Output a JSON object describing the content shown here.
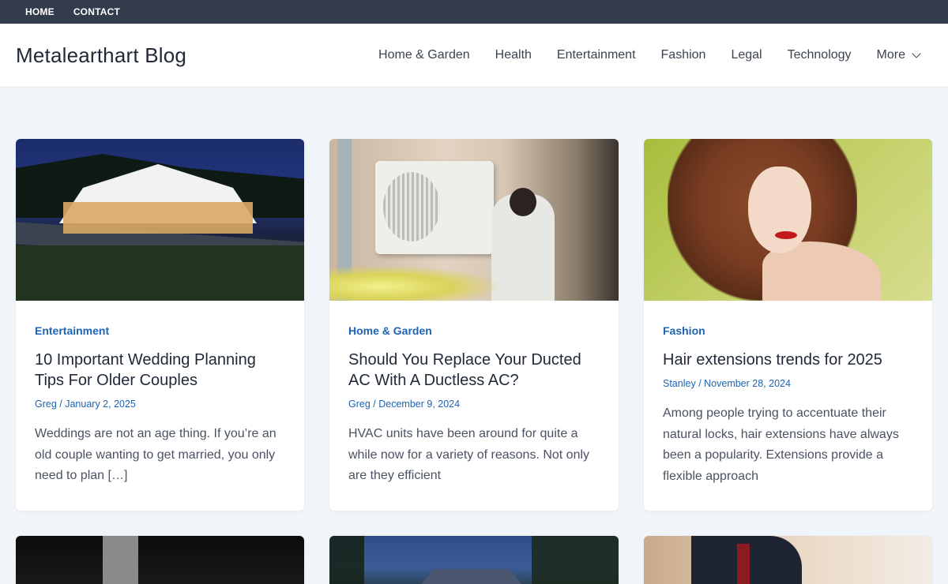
{
  "topbar": {
    "links": [
      "HOME",
      "CONTACT"
    ]
  },
  "header": {
    "logo": "Metalearthart Blog",
    "nav": [
      "Home & Garden",
      "Health",
      "Entertainment",
      "Fashion",
      "Legal",
      "Technology",
      "More"
    ]
  },
  "posts": [
    {
      "category": "Entertainment",
      "title": "10 Important Wedding Planning Tips For Older Couples",
      "author": "Greg",
      "date": "January 2, 2025",
      "excerpt": "Weddings are not an age thing. If you’re an old couple wanting to get married, you only need to plan […]"
    },
    {
      "category": "Home & Garden",
      "title": "Should You Replace Your Ducted AC With A Ductless AC?",
      "author": "Greg",
      "date": "December 9, 2024",
      "excerpt": "HVAC units have been around for quite a while now for a variety of reasons. Not only are they efficient"
    },
    {
      "category": "Fashion",
      "title": "Hair extensions trends for 2025",
      "author": "Stanley",
      "date": "November 28, 2024",
      "excerpt": "Among people trying to accentuate their natural locks, hair extensions have always been a popularity. Extensions provide a flexible approach"
    }
  ],
  "meta_separator": "/",
  "icons": {
    "more": "chevron-down-icon"
  },
  "colors": {
    "topbar": "#323c4c",
    "accent": "#1d64b3",
    "background": "#f0f5fa"
  }
}
